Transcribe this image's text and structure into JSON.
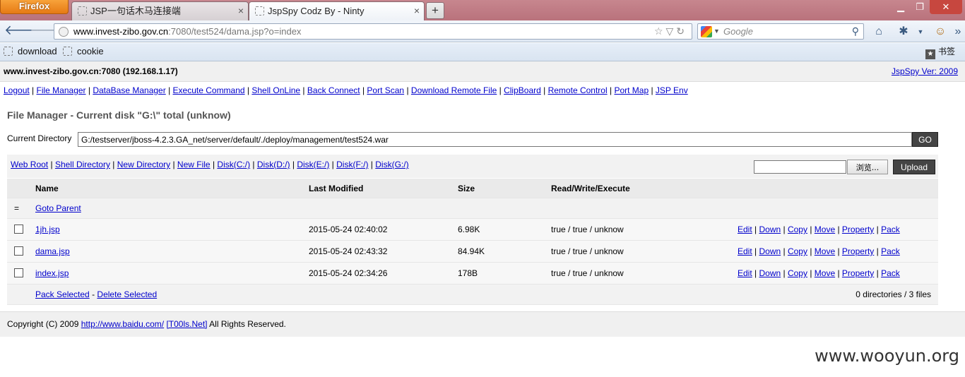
{
  "browser": {
    "app_button": "Firefox",
    "tabs": [
      {
        "title": "JSP一句话木马连接端"
      },
      {
        "title": "JspSpy Codz By - Ninty"
      }
    ],
    "url_domain": "www.invest-zibo.gov.cn",
    "url_rest": ":7080/test524/dama.jsp?o=index",
    "search_placeholder": "Google",
    "bookmarks": [
      "download",
      "cookie"
    ],
    "bookmarks_menu": "书签"
  },
  "page": {
    "host": "www.invest-zibo.gov.cn:7080 (192.168.1.17)",
    "version": "JspSpy Ver: 2009",
    "menu": [
      "Logout",
      "File Manager",
      "DataBase Manager",
      "Execute Command",
      "Shell OnLine",
      "Back Connect",
      "Port Scan",
      "Download Remote File",
      "ClipBoard",
      "Remote Control",
      "Port Map",
      "JSP Env"
    ],
    "title": "File Manager - Current disk \"G:\\\" total (unknow)",
    "current_dir_label": "Current Directory",
    "current_dir_value": "G:/testserver/jboss-4.2.3.GA_net/server/default/./deploy/management/test524.war",
    "go_label": "GO",
    "tool_links": [
      "Web Root",
      "Shell Directory",
      "New Directory",
      "New File",
      "Disk(C:/)",
      "Disk(D:/)",
      "Disk(E:/)",
      "Disk(F:/)",
      "Disk(G:/)"
    ],
    "browse_label": "浏览...",
    "upload_label": "Upload",
    "columns": {
      "name": "Name",
      "modified": "Last Modified",
      "size": "Size",
      "rwe": "Read/Write/Execute"
    },
    "parent_symbol": "=",
    "parent_label": "Goto Parent",
    "files": [
      {
        "name": "1jh.jsp",
        "modified": "2015-05-24 02:40:02",
        "size": "6.98K",
        "rwe": "true / true / unknow"
      },
      {
        "name": "dama.jsp",
        "modified": "2015-05-24 02:43:32",
        "size": "84.94K",
        "rwe": "true / true / unknow"
      },
      {
        "name": "index.jsp",
        "modified": "2015-05-24 02:34:26",
        "size": "178B",
        "rwe": "true / true / unknow"
      }
    ],
    "actions": [
      "Edit",
      "Down",
      "Copy",
      "Move",
      "Property",
      "Pack"
    ],
    "pack_selected": "Pack Selected",
    "delete_selected": "Delete Selected",
    "footer_separator": "-",
    "count_text": "0 directories / 3 files",
    "copyright_prefix": "Copyright (C) 2009",
    "copyright_link1": "http://www.baidu.com/",
    "copyright_link2": "[T00ls.Net]",
    "copyright_suffix": "All Rights Reserved."
  },
  "watermark": "www.wooyun.org"
}
